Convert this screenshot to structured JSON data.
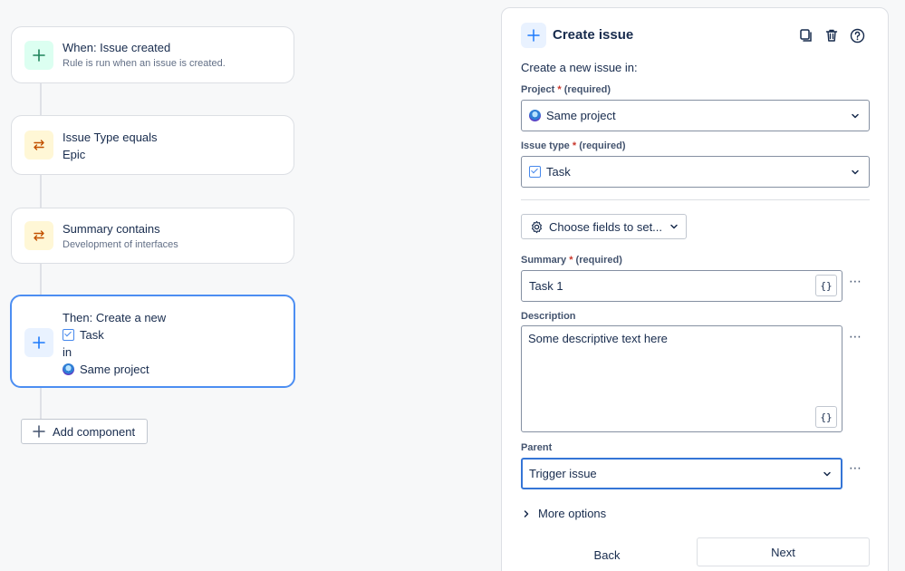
{
  "flow": {
    "trigger": {
      "title": "When: Issue created",
      "subtitle": "Rule is run when an issue is created."
    },
    "condition1": {
      "title": "Issue Type equals",
      "value": "Epic"
    },
    "condition2": {
      "title": "Summary contains",
      "subtitle": "Development of interfaces"
    },
    "action": {
      "title": "Then: Create a new",
      "issue_type": "Task",
      "in_label": "in",
      "project": "Same project"
    },
    "add_component_label": "Add component"
  },
  "panel": {
    "title": "Create issue",
    "intro": "Create a new issue in:",
    "project": {
      "label": "Project",
      "required": "(required)",
      "value": "Same project"
    },
    "issue_type": {
      "label": "Issue type",
      "required": "(required)",
      "value": "Task"
    },
    "choose_fields_label": "Choose fields to set...",
    "summary": {
      "label": "Summary",
      "required": "(required)",
      "value": "Task 1",
      "brace": "{}"
    },
    "description": {
      "label": "Description",
      "value": "Some descriptive text here",
      "brace": "{}"
    },
    "parent": {
      "label": "Parent",
      "value": "Trigger issue"
    },
    "more_options_label": "More options",
    "back_label": "Back",
    "next_label": "Next",
    "more_icon": "⋯",
    "required_star": "*"
  },
  "icons": {
    "trigger": "plus-icon",
    "condition": "swap-arrows-icon",
    "action": "plus-icon",
    "duplicate": "duplicate-icon",
    "delete": "trash-icon",
    "help": "help-icon",
    "settings": "gear-icon",
    "chevron": "chevron-down-icon"
  },
  "colors": {
    "selected_border": "#4c8ef2",
    "required_star": "#c9372c",
    "focused_border": "#3575d6",
    "trigger_badge": "#dcfff1",
    "condition_badge": "#fff7d6",
    "action_badge": "#e9f2ff"
  }
}
